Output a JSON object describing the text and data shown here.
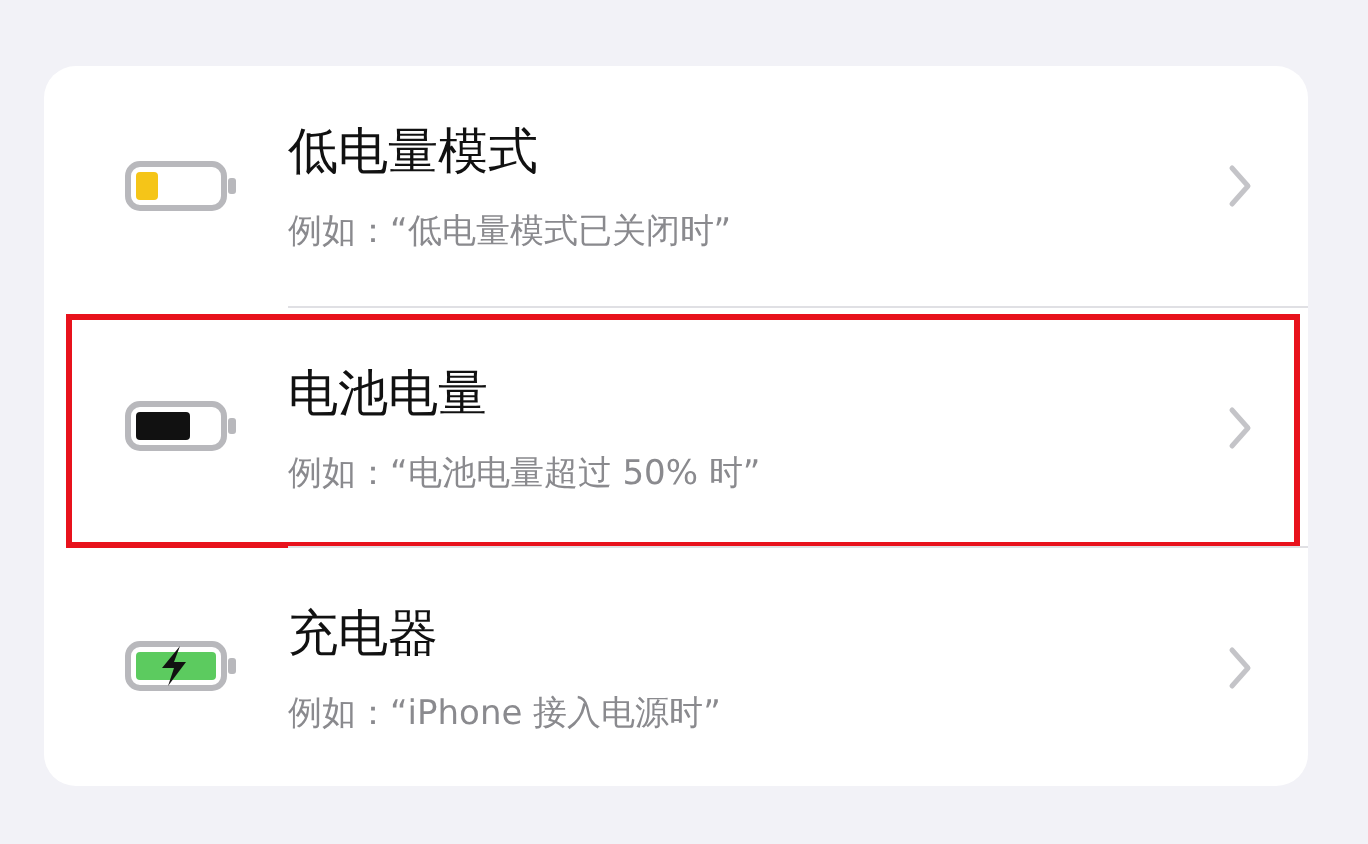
{
  "rows": [
    {
      "kind": "low-power",
      "title": "低电量模式",
      "subtitle": "例如：“低电量模式已关闭时”",
      "highlighted": false
    },
    {
      "kind": "battery-level",
      "title": "电池电量",
      "subtitle": "例如：“电池电量超过 50% 时”",
      "highlighted": true
    },
    {
      "kind": "charging",
      "title": "充电器",
      "subtitle": "例如：“iPhone 接入电源时”",
      "highlighted": false
    }
  ]
}
